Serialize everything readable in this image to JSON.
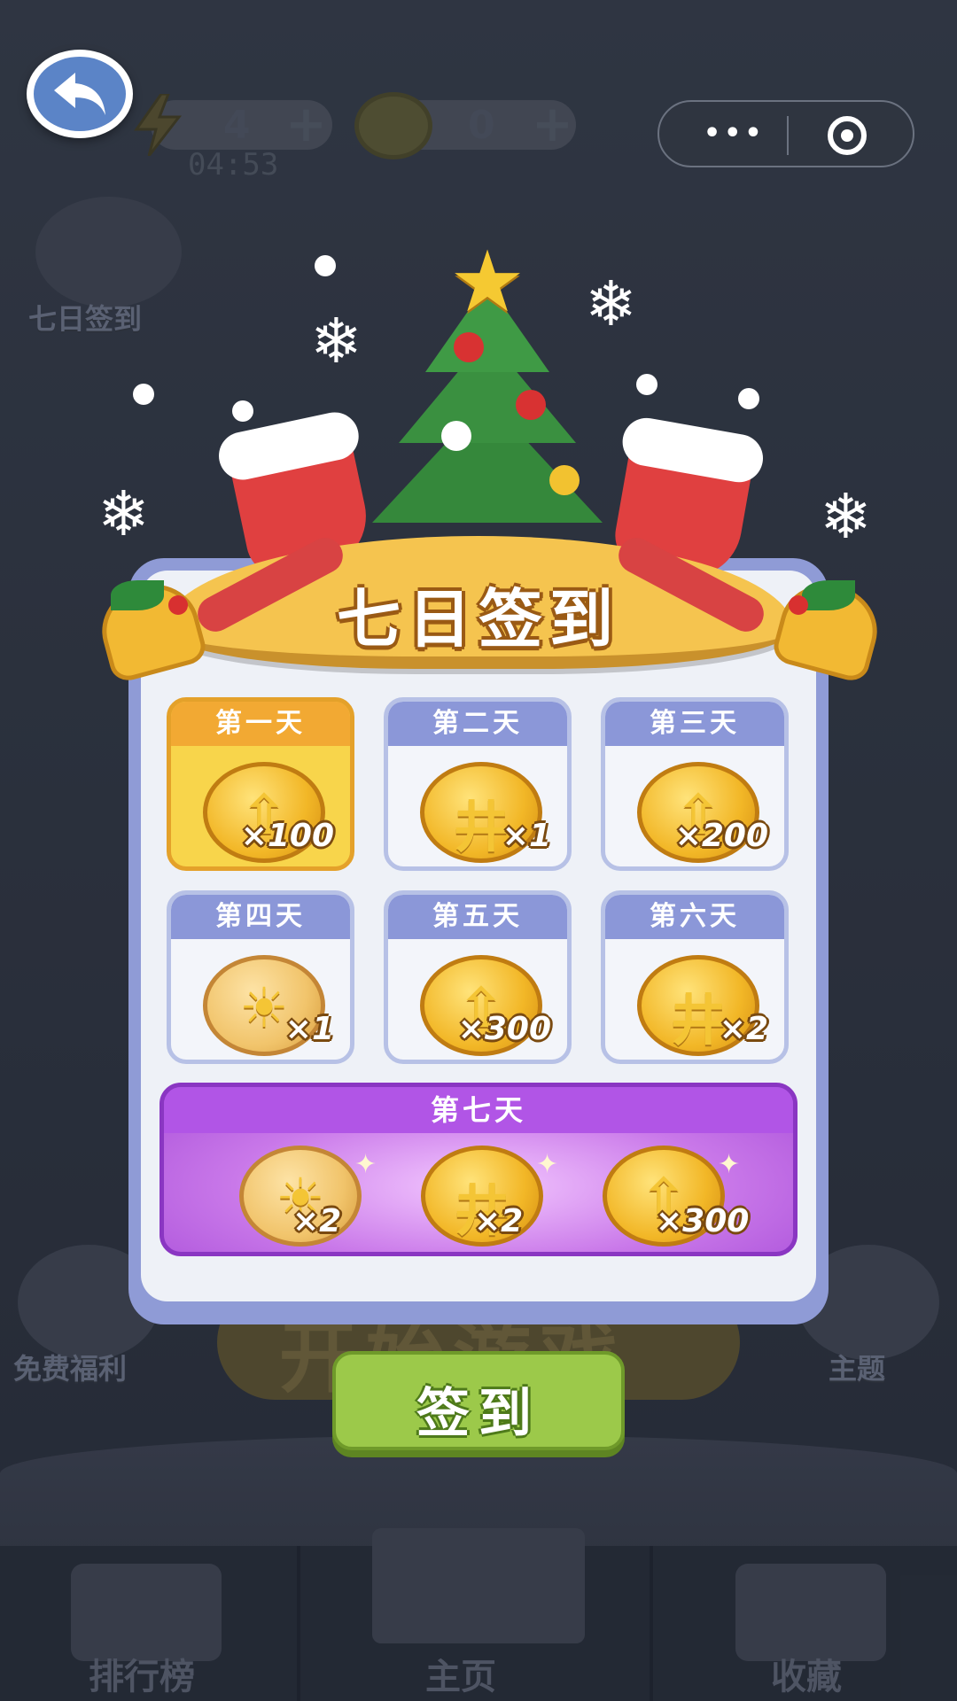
{
  "header": {
    "energy_value": "4",
    "timer": "04:53",
    "coin_value": "0",
    "plus_label": "+"
  },
  "side_buttons": {
    "checkin_label": "七日签到",
    "free_gift_label": "免费福利",
    "theme_label": "主题"
  },
  "start_button_label": "开始游戏",
  "bottom_nav": {
    "rank_label": "排行榜",
    "home_label": "主页",
    "collection_label": "收藏"
  },
  "modal": {
    "title": "七日签到",
    "days": [
      {
        "label": "第一天",
        "reward_icon": "arrow-coin-icon",
        "quantity": "×100",
        "state": "today"
      },
      {
        "label": "第二天",
        "reward_icon": "grid-coin-icon",
        "quantity": "×1",
        "state": "locked"
      },
      {
        "label": "第三天",
        "reward_icon": "arrow-coin-icon",
        "quantity": "×200",
        "state": "locked"
      },
      {
        "label": "第四天",
        "reward_icon": "bulb-coin-icon",
        "quantity": "×1",
        "state": "locked"
      },
      {
        "label": "第五天",
        "reward_icon": "arrow-coin-icon",
        "quantity": "×300",
        "state": "locked"
      },
      {
        "label": "第六天",
        "reward_icon": "grid-coin-icon",
        "quantity": "×2",
        "state": "locked"
      }
    ],
    "day7": {
      "label": "第七天",
      "rewards": [
        {
          "reward_icon": "bulb-coin-icon",
          "quantity": "×2"
        },
        {
          "reward_icon": "grid-coin-icon",
          "quantity": "×2"
        },
        {
          "reward_icon": "arrow-coin-icon",
          "quantity": "×300"
        }
      ]
    },
    "signin_button_label": "签到"
  },
  "colors": {
    "today_card": "#f8d54b",
    "card_header": "#8b97d8",
    "day7_purple": "#b155e6",
    "signin_green": "#9cc94a"
  }
}
